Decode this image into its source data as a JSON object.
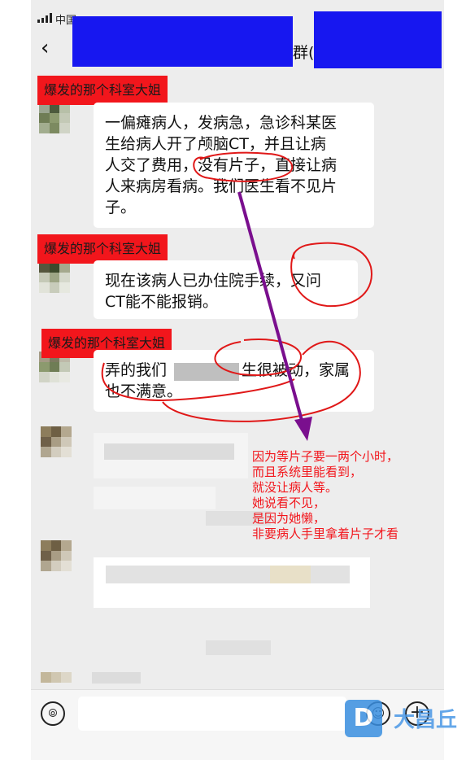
{
  "status_bar": {
    "carrier": "中国"
  },
  "nav": {
    "back_icon": "chevron-left-icon",
    "title_suffix": "群("
  },
  "messages": [
    {
      "nickname": "爆发的那个科室大姐",
      "lines": [
        "一偏瘫病人，发病急，急诊科某医",
        "生给病人开了颅脑CT，并且让病",
        "人交了费用，没有片子，直接让病",
        "人来病房看病。我们医生看不见片",
        "子。"
      ]
    },
    {
      "nickname": "爆发的那个科室大姐",
      "lines": [
        "现在该病人已办住院手续，又问",
        "CT能不能报销。"
      ]
    },
    {
      "nickname": "爆发的那个科室大姐",
      "line1_start": "弄的我们",
      "line1_end": "生很被动，家属",
      "line2": "也不满意。"
    }
  ],
  "annotation": {
    "color": "#f2161c",
    "lines": [
      "因为等片子要一两个小时，",
      "而且系统里能看到，",
      "就没让病人等。",
      "她说看不见，",
      "是因为她懒，",
      "非要病人手里拿着片子才看"
    ]
  },
  "input_bar": {
    "voice_icon": "voice-icon",
    "emoji_icon": "emoji-icon",
    "plus_icon": "plus-icon"
  },
  "watermark": {
    "logo": "D",
    "text": "大昌丘"
  },
  "colors": {
    "redaction_blue": "#1717f0",
    "nickname_red": "#f2161c",
    "arrow_purple": "#7a0f8e",
    "chat_bg": "#ededed"
  }
}
